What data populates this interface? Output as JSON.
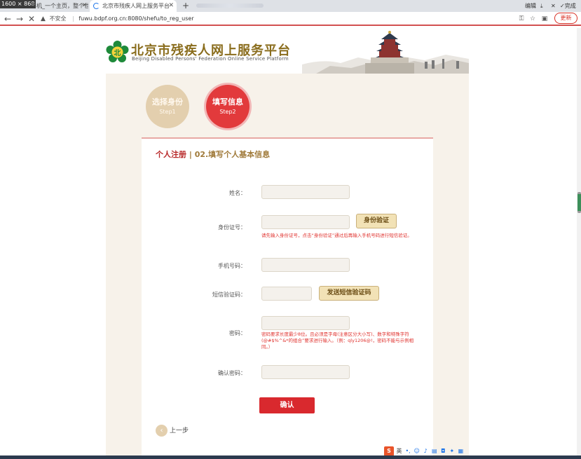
{
  "browser": {
    "dimensions_badge": "1600 × 868",
    "tabs": [
      {
        "title": "…平机_一个主页，整个世界",
        "active": false
      },
      {
        "title": "北京市残疾人网上服务平台",
        "active": true
      }
    ],
    "new_tab": "+",
    "window_controls": {
      "edit": "编辑",
      "done": "完成",
      "minimize": "—",
      "maximize": "▢",
      "close": "✕"
    },
    "address": {
      "security": "不安全",
      "url": "fuwu.bdpf.org.cn:8080/shefu/to_reg_user"
    },
    "update_button": "更新"
  },
  "header": {
    "title": "北京市残疾人网上服务平台",
    "subtitle": "Beijing Disabled Persons' Federation Online Service Platform",
    "logo_char": "北"
  },
  "steps": [
    {
      "title": "选择身份",
      "sub": "Step1",
      "state": "done"
    },
    {
      "title": "填写信息",
      "sub": "Step2",
      "state": "active"
    }
  ],
  "section": {
    "title_main": "个人注册",
    "title_sep": " | ",
    "title_rest": "02.填写个人基本信息"
  },
  "form": {
    "name_label": "姓名：",
    "id_label": "身份证号：",
    "id_verify_button": "身份验证",
    "id_hint": "请先输入身份证号，点击“身份验证”通过后再输入手机号码进行短信验证。",
    "phone_label": "手机号码：",
    "sms_label": "短信验证码：",
    "sms_send_button": "发送短信验证码",
    "password_label": "密码：",
    "password_hint": "密码要求长度最少8位。且必须是字母(注意区分大小写)、数字和特殊字符(@#$%^&*的组合”要求进行输入。（例：qly1206@!，密码不能与示例相同。）",
    "confirm_label": "确认密码：",
    "submit_button": "确认",
    "back_link": "上一步"
  },
  "ime_toolbar": {
    "logo": "S",
    "lang": "英"
  },
  "colors": {
    "accent_red": "#d9292e",
    "gold": "#8a6d1d",
    "beige": "#f7f2ea",
    "step_done": "#e3cfae"
  }
}
